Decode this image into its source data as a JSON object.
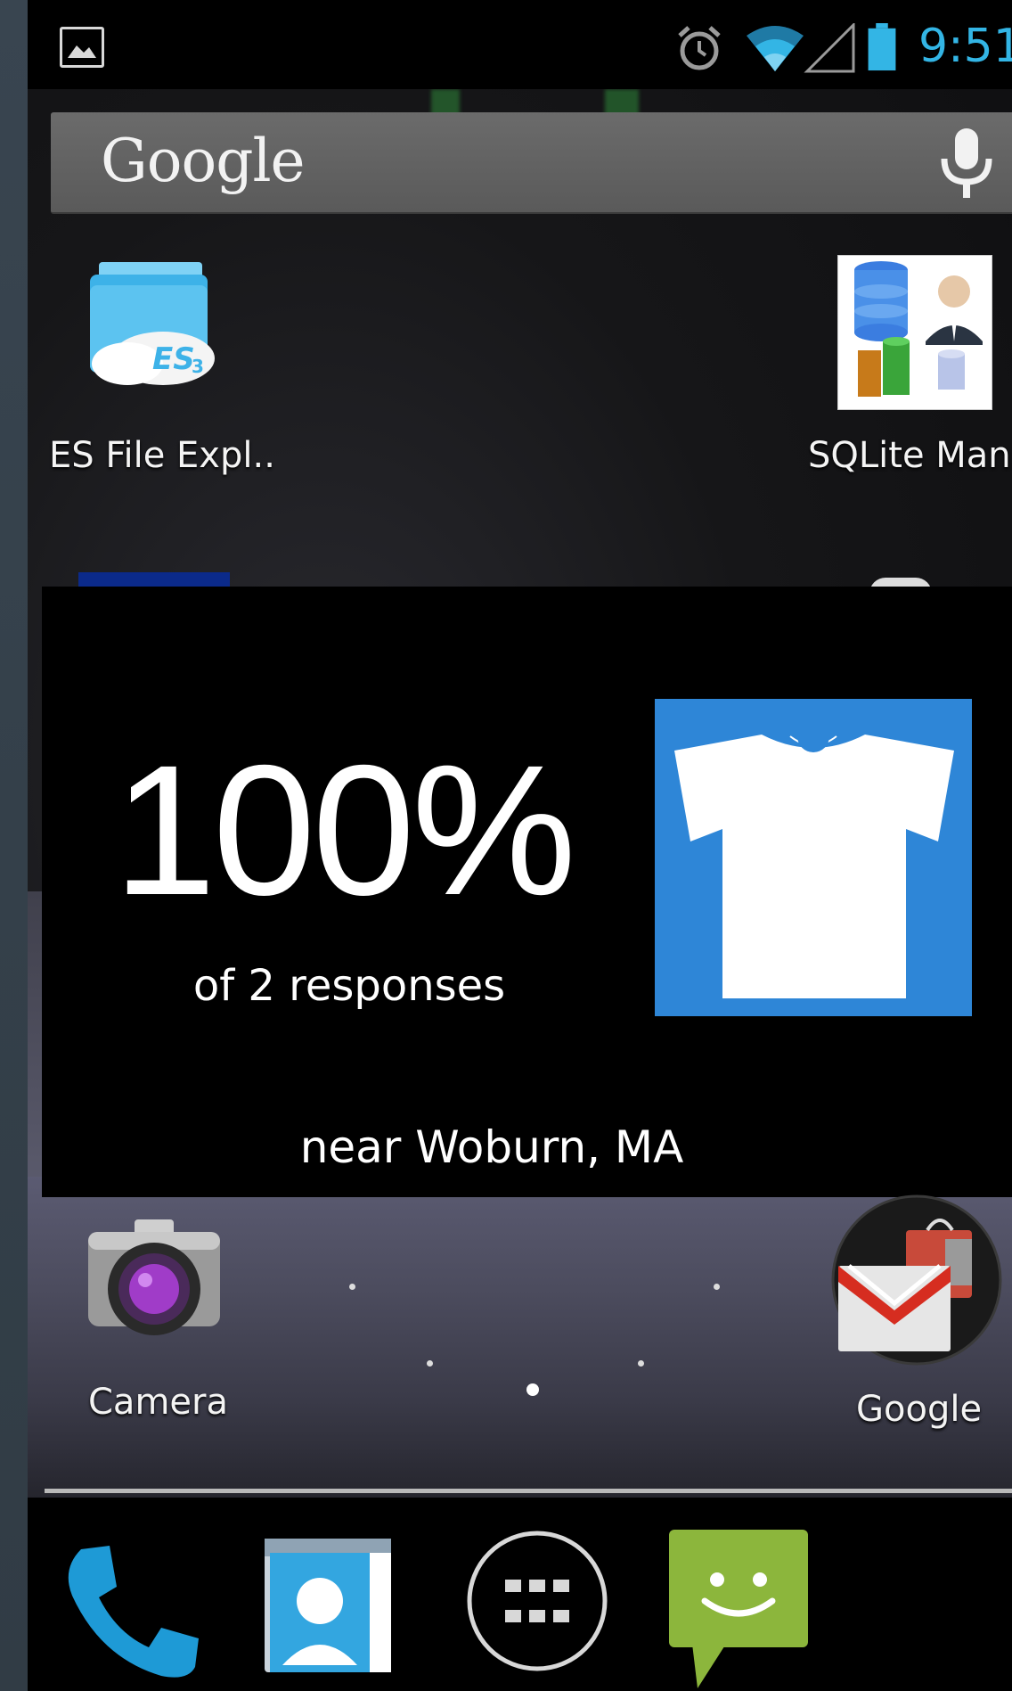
{
  "status_bar": {
    "time": "9:51",
    "notification_icon": "picture-icon",
    "icons": [
      "alarm-icon",
      "wifi-icon",
      "signal-icon",
      "battery-icon"
    ]
  },
  "search": {
    "logo_text": "Google",
    "voice_icon": "microphone-icon"
  },
  "apps": {
    "es_file": "ES File Expl..",
    "sqlite": "SQLite Man..",
    "camera": "Camera",
    "google_folder": "Google"
  },
  "widget": {
    "percent": "100%",
    "responses": "of 2 responses",
    "location": "near Woburn, MA",
    "image_icon": "t-shirt-icon",
    "image_bg": "#2e86d7"
  },
  "dock": {
    "items": [
      "phone-icon",
      "contacts-icon",
      "all-apps-icon",
      "messaging-icon"
    ]
  },
  "colors": {
    "accent": "#33b5e5",
    "messaging": "#8cb63c",
    "phone": "#1e9ad6"
  }
}
